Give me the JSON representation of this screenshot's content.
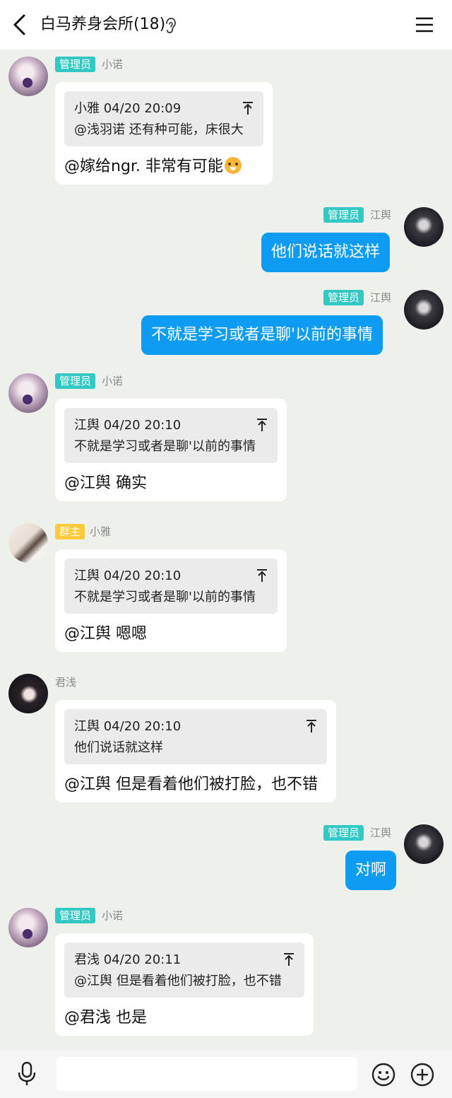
{
  "header": {
    "title": "白马养身会所(18)",
    "icons": [
      "back-arrow-icon",
      "ear-icon",
      "menu-icon"
    ]
  },
  "colors": {
    "outgoing_bubble": "#0e9cf3",
    "admin_tag": "#33c8c4",
    "owner_tag": "#ffc93a",
    "chat_background": "#eef0ec"
  },
  "messages": [
    {
      "direction": "in",
      "role": "管理员",
      "sender": "小诺",
      "quote": {
        "header": "小雅 04/20 20:09",
        "text": "@浅羽诺 还有种可能，床很大"
      },
      "text": "@嫁给ngr. 非常有可能",
      "emoji": "doge-emoji"
    },
    {
      "direction": "out",
      "role": "管理员",
      "sender": "江舆",
      "text": "他们说话就这样"
    },
    {
      "direction": "out",
      "role": "管理员",
      "sender": "江舆",
      "text": "不就是学习或者是聊'以前的事情"
    },
    {
      "direction": "in",
      "role": "管理员",
      "sender": "小诺",
      "quote": {
        "header": "江舆 04/20 20:10",
        "text": "不就是学习或者是聊'以前的事情"
      },
      "text": "@江舆 确实"
    },
    {
      "direction": "in",
      "role": "群主",
      "sender": "小雅",
      "quote": {
        "header": "江舆 04/20 20:10",
        "text": "不就是学习或者是聊'以前的事情"
      },
      "text": "@江舆 嗯嗯"
    },
    {
      "direction": "in",
      "role": "",
      "sender": "君浅",
      "quote": {
        "header": "江舆 04/20 20:10",
        "text": "他们说话就这样"
      },
      "text": "@江舆 但是看着他们被打脸，也不错"
    },
    {
      "direction": "out",
      "role": "管理员",
      "sender": "江舆",
      "text": "对啊"
    },
    {
      "direction": "in",
      "role": "管理员",
      "sender": "小诺",
      "quote": {
        "header": "君浅 04/20 20:11",
        "text": "@江舆 但是看着他们被打脸，也不错"
      },
      "text": "@君浅 也是"
    }
  ],
  "footer": {
    "input_value": "",
    "icons": [
      "microphone-icon",
      "emoji-icon",
      "plus-icon"
    ]
  }
}
